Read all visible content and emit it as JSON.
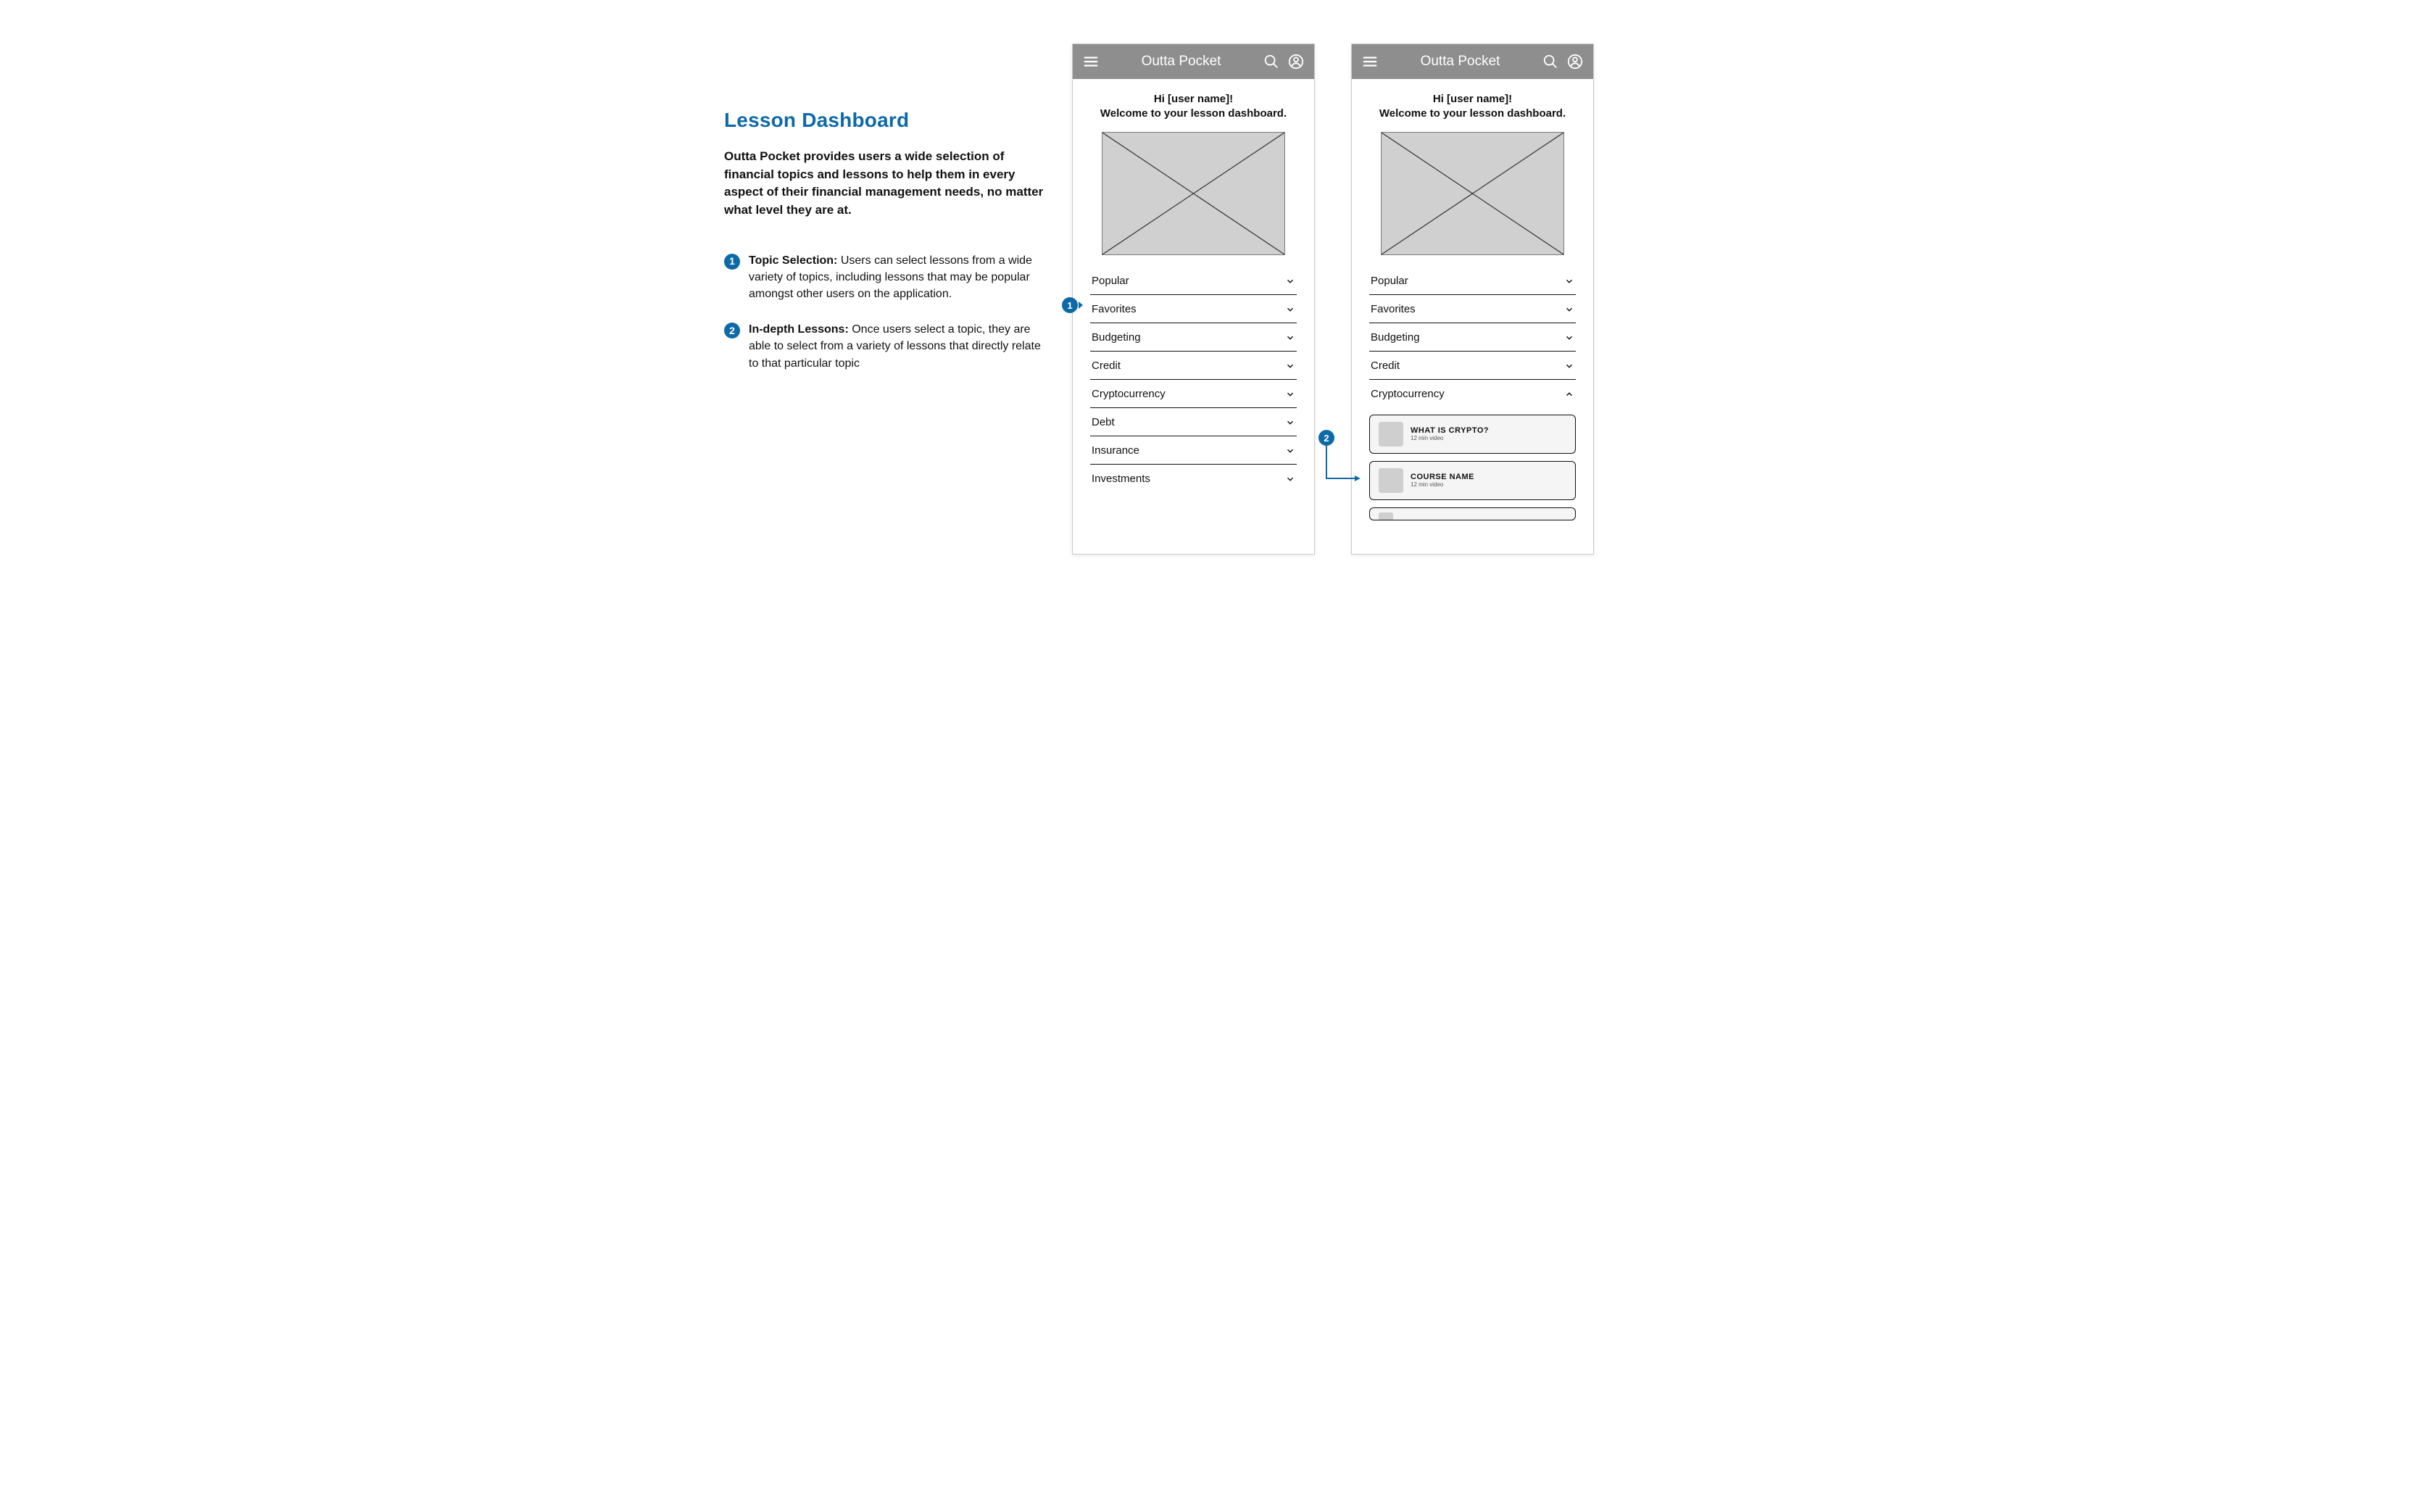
{
  "section": {
    "title": "Lesson Dashboard",
    "description": "Outta Pocket provides users a wide selection of financial topics and lessons to help them in every aspect of their financial management needs, no matter what level they are at."
  },
  "callouts": [
    {
      "num": "1",
      "label": "Topic Selection:",
      "text": " Users can select lessons from a wide variety of topics, including lessons that may be popular amongst other users on the application."
    },
    {
      "num": "2",
      "label": "In-depth Lessons:",
      "text": " Once users select a topic, they are able to select from a variety of lessons that directly relate to that particular topic"
    }
  ],
  "app": {
    "title": "Outta Pocket"
  },
  "welcome": {
    "line1": "Hi [user name]!",
    "line2": "Welcome to your lesson dashboard."
  },
  "mock_a": {
    "items": [
      {
        "label": "Popular"
      },
      {
        "label": "Favorites"
      },
      {
        "label": "Budgeting"
      },
      {
        "label": "Credit"
      },
      {
        "label": "Cryptocurrency"
      },
      {
        "label": "Debt"
      },
      {
        "label": "Insurance"
      },
      {
        "label": "Investments"
      }
    ]
  },
  "mock_b": {
    "items": [
      {
        "label": "Popular"
      },
      {
        "label": "Favorites"
      },
      {
        "label": "Budgeting"
      },
      {
        "label": "Credit"
      },
      {
        "label": "Cryptocurrency"
      }
    ],
    "lessons": [
      {
        "title": "WHAT IS CRYPTO?",
        "sub": "12 min video"
      },
      {
        "title": "COURSE NAME",
        "sub": "12 min video"
      }
    ]
  },
  "markers": {
    "m1": "1",
    "m2": "2"
  }
}
